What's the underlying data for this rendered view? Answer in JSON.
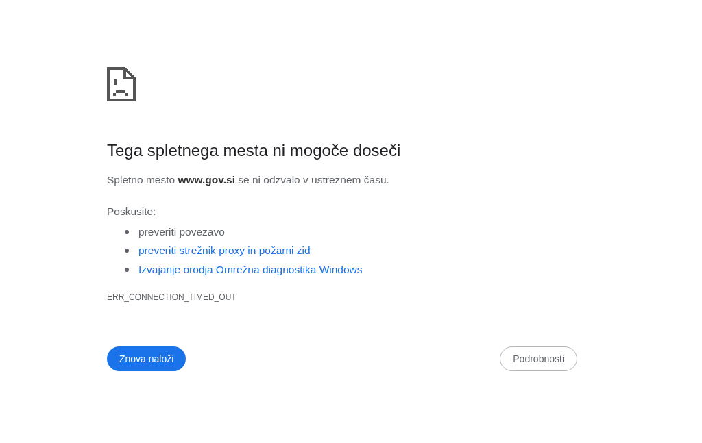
{
  "heading": "Tega spletnega mesta ni mogoče doseči",
  "message": "Spletno mesto **www.gov.si** se ni odzvalo v ustreznem času.",
  "suggestions_label": "Poskusite:",
  "suggestions": [
    {
      "kind": "text",
      "text": "preveriti povezavo"
    },
    {
      "kind": "link",
      "text": "preveriti strežnik proxy in požarni zid"
    },
    {
      "kind": "link",
      "text": "Izvajanje orodja Omrežna diagnostika Windows"
    }
  ],
  "error_code": "ERR_CONNECTION_TIMED_OUT",
  "buttons": [
    {
      "kind": "primary",
      "label": "Znova naloži"
    },
    {
      "kind": "secondary",
      "label": "Podrobnosti"
    }
  ]
}
